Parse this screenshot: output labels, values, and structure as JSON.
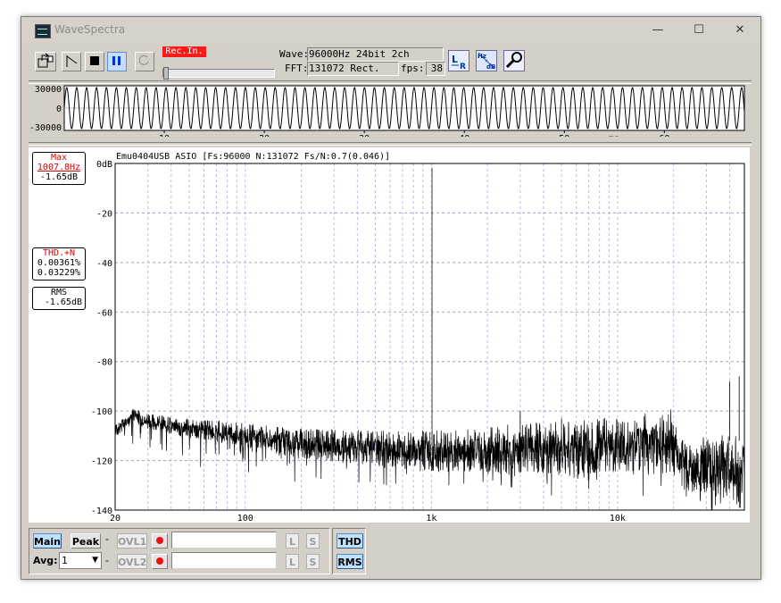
{
  "window": {
    "title": "WaveSpectra",
    "minimize": "—",
    "maximize": "☐",
    "close": "✕"
  },
  "toolbar": {
    "rec_in_label": "Rec.In.",
    "wave_label": "Wave:",
    "wave_value": "96000Hz 24bit 2ch",
    "fft_label": "FFT:",
    "fft_value": "131072 Rect.",
    "fps_label": "fps:",
    "fps_value": "38",
    "lr_icon": "L R",
    "hzdb_icon_hz": "Hz",
    "hzdb_icon_db": "dB"
  },
  "waveform": {
    "y_ticks": [
      "30000",
      "0",
      "-30000"
    ],
    "x_ticks": [
      "10",
      "20",
      "30",
      "40",
      "50",
      "60"
    ],
    "x_unit": "ms",
    "x_max_ms": 68,
    "cycles_per_ms": 1.0078
  },
  "spectrum": {
    "header": "Emu0404USB ASIO  [Fs:96000 N:131072 Fs/N:0.7(0.046)]",
    "max_label": "Max",
    "max_freq": "1007.8Hz",
    "max_level": "-1.65dB",
    "thd_label": "THD.+N",
    "thd_value1": "0.00361%",
    "thd_value2": "0.03229%",
    "rms_label": "RMS",
    "rms_value": "-1.65dB",
    "y_ticks": [
      "0dB",
      "-20",
      "-40",
      "-60",
      "-80",
      "-100",
      "-120",
      "-140"
    ],
    "x_ticks": [
      "20",
      "100",
      "1k",
      "10k"
    ]
  },
  "chart_data": {
    "type": "line",
    "title": "",
    "xlabel": "",
    "ylabel": "",
    "x_scale": "log",
    "xlim": [
      20,
      48000
    ],
    "ylim": [
      -140,
      0
    ],
    "grid": true,
    "series": [
      {
        "x": [
          20,
          25,
          30,
          40,
          50,
          70,
          100,
          150,
          200,
          300,
          500,
          700,
          1007.8,
          1500,
          2000,
          3000,
          5000,
          10000,
          15000,
          20000,
          22000,
          30000,
          40000,
          48000
        ],
        "y": [
          -108,
          -102,
          -104,
          -106,
          -107,
          -108,
          -110,
          -112,
          -113,
          -114,
          -115,
          -116,
          -1.65,
          -116,
          -116,
          -115,
          -115,
          -114,
          -113,
          -112,
          -122,
          -124,
          -123,
          -126
        ]
      }
    ],
    "spurs": [
      {
        "x": 3000,
        "y": -100
      },
      {
        "x": 5000,
        "y": -103
      },
      {
        "x": 40000,
        "y": -88
      },
      {
        "x": 45000,
        "y": -86
      }
    ]
  },
  "bottom": {
    "main_label": "Main",
    "peak_label": "Peak",
    "dash": "-",
    "ovl1_label": "OVL1",
    "ovl2_label": "OVL2",
    "l_label": "L",
    "s_label": "S",
    "thd_label": "THD",
    "rms_label": "RMS",
    "avg_label": "Avg:",
    "avg_value": "1"
  }
}
